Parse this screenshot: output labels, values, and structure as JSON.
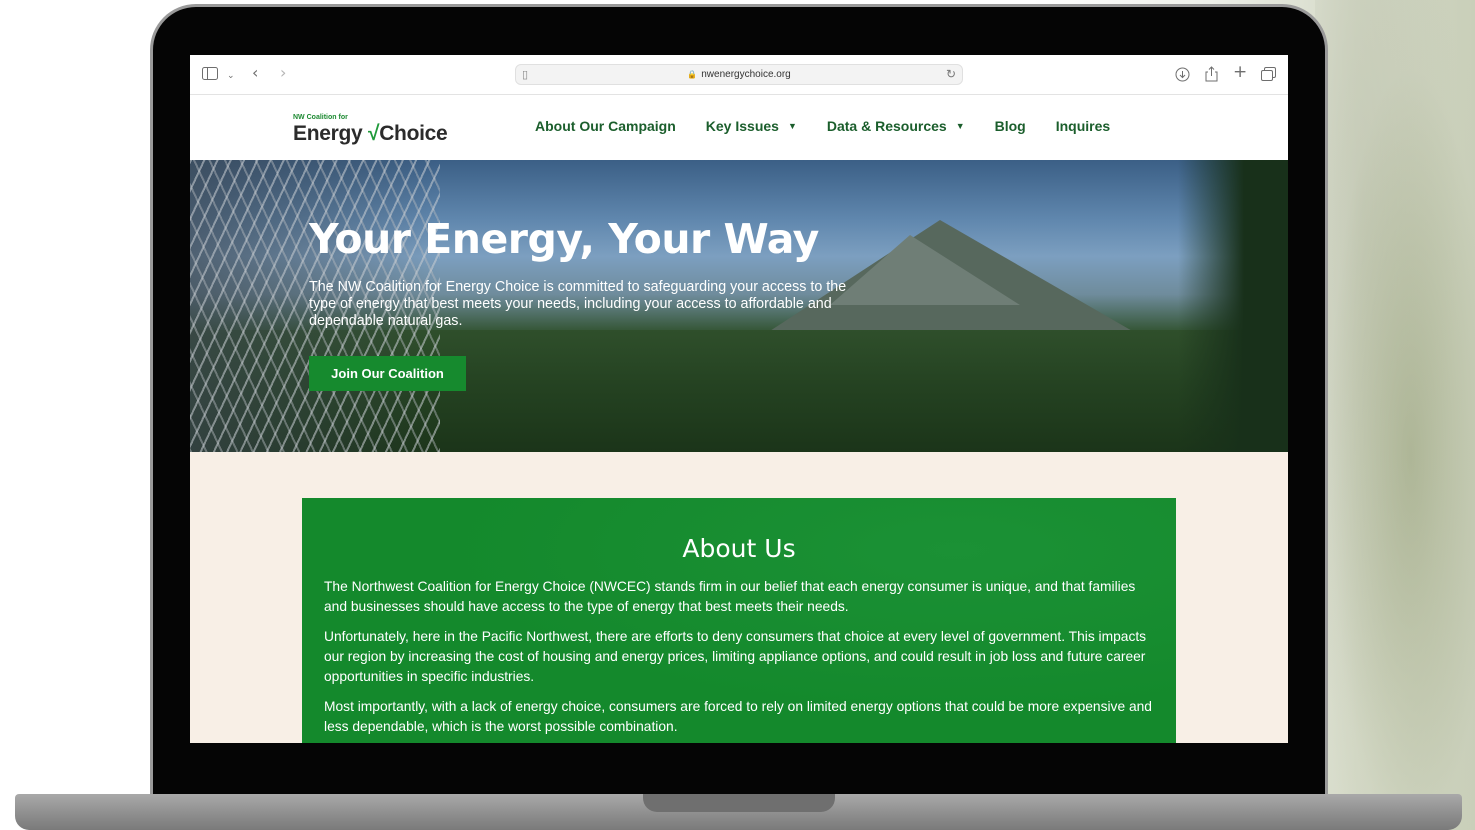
{
  "browser": {
    "url": "nwenergychoice.org"
  },
  "site": {
    "logo_small": "NW Coalition for",
    "logo_word1": "Energy",
    "logo_check": "√",
    "logo_word2": "Choice",
    "nav": [
      {
        "label": "About Our Campaign",
        "has_dropdown": false
      },
      {
        "label": "Key Issues",
        "has_dropdown": true
      },
      {
        "label": "Data & Resources",
        "has_dropdown": true
      },
      {
        "label": "Blog",
        "has_dropdown": false
      },
      {
        "label": "Inquires",
        "has_dropdown": false
      }
    ]
  },
  "hero": {
    "title": "Your Energy, Your Way",
    "description": "The NW Coalition for Energy Choice is committed to safeguarding your access to the type of energy that best meets your needs, including your access to affordable and dependable natural gas.",
    "button": "Join Our Coalition"
  },
  "about": {
    "title": "About Us",
    "paragraphs": [
      "The Northwest Coalition for Energy Choice (NWCEC) stands firm in our belief that each energy consumer is unique, and that families and businesses should have access to the type of energy that best meets their needs.",
      "Unfortunately, here in the Pacific Northwest, there are efforts to deny consumers that choice at every level of government. This impacts our region by increasing the cost of housing and energy prices, limiting appliance options, and could result in job loss and future career opportunities in specific industries.",
      "Most importantly, with a lack of energy choice, consumers are forced to rely on limited energy options that could be more expensive and less dependable, which is the worst possible combination."
    ]
  },
  "colors": {
    "brand_green": "#168a2e",
    "nav_text": "#1b5e2c",
    "section_bg": "#f8efe6"
  }
}
